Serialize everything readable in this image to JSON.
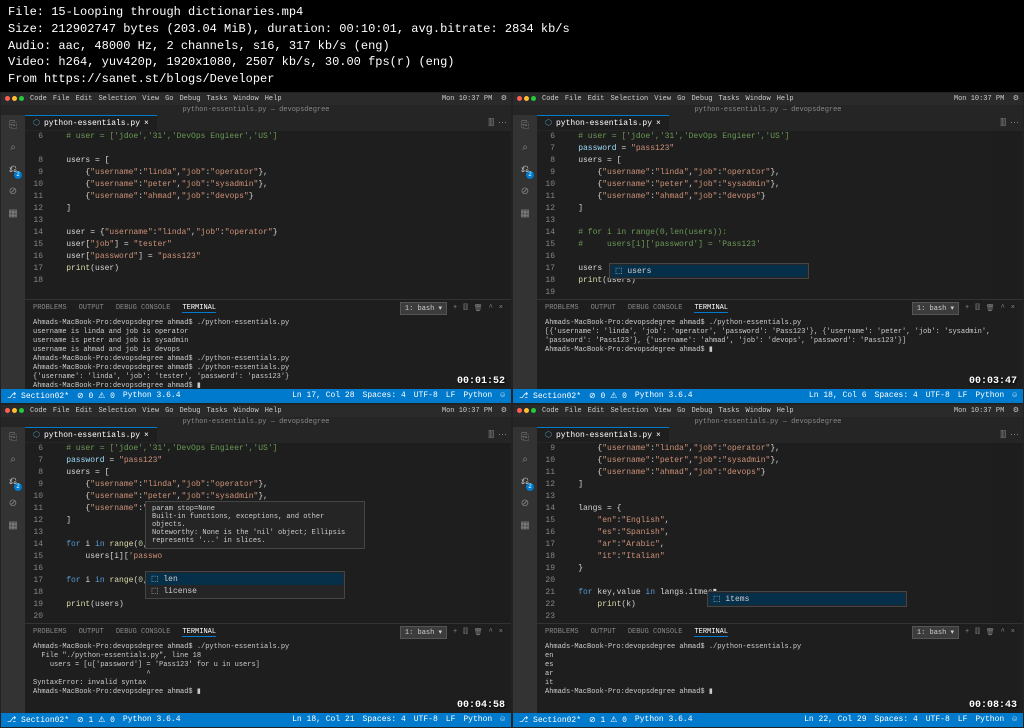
{
  "header": {
    "file_label": "File:",
    "file_value": "15-Looping through dictionaries.mp4",
    "size_label": "Size:",
    "size_value": "212902747 bytes (203.04 MiB), duration: 00:10:01, avg.bitrate: 2834 kb/s",
    "audio_label": "Audio:",
    "audio_value": "aac, 48000 Hz, 2 channels, s16, 317 kb/s (eng)",
    "video_label": "Video:",
    "video_value": "h264, yuv420p, 1920x1080, 2507 kb/s, 30.00 fps(r) (eng)",
    "from_label": "From",
    "from_value": "https://sanet.st/blogs/Developer"
  },
  "mac_menu": [
    "Code",
    "File",
    "Edit",
    "Selection",
    "View",
    "Go",
    "Debug",
    "Tasks",
    "Window",
    "Help"
  ],
  "titlebar": "python-essentials.py — devopsdegree",
  "tab_name": "python-essentials.py",
  "panel_tabs": [
    "PROBLEMS",
    "OUTPUT",
    "DEBUG CONSOLE",
    "TERMINAL"
  ],
  "term_shell": "1: bash",
  "panes": {
    "a": {
      "lines": [
        "6",
        "",
        "8",
        "9",
        "10",
        "11",
        "12",
        "13",
        "14",
        "15",
        "16",
        "17",
        "18"
      ],
      "code": "    <span class='c-c'># user = ['jdoe','31','DevOps Engieer','US']</span>\n\n    users = [\n        {<span class='c-s'>\"username\"</span>:<span class='c-s'>\"linda\"</span>,<span class='c-s'>\"job\"</span>:<span class='c-s'>\"operator\"</span>},\n        {<span class='c-s'>\"username\"</span>:<span class='c-s'>\"peter\"</span>,<span class='c-s'>\"job\"</span>:<span class='c-s'>\"sysadmin\"</span>},\n        {<span class='c-s'>\"username\"</span>:<span class='c-s'>\"ahmad\"</span>,<span class='c-s'>\"job\"</span>:<span class='c-s'>\"devops\"</span>}\n    ]\n\n    user = {<span class='c-s'>\"username\"</span>:<span class='c-s'>\"linda\"</span>,<span class='c-s'>\"job\"</span>:<span class='c-s'>\"operator\"</span>}\n    user[<span class='c-s'>\"job\"</span>] = <span class='c-s'>\"tester\"</span>\n    user[<span class='c-s'>\"password\"</span>] = <span class='c-s'>\"pass123\"</span>\n    <span class='c-f'>print</span>(user)",
      "terminal": "Ahmads-MacBook-Pro:devopsdegree ahmad$ ./python-essentials.py\nusername is linda and job is operator\nusername is peter and job is sysadmin\nusername is ahmad and job is devops\nAhmads-MacBook-Pro:devopsdegree ahmad$ ./python-essentials.py\nAhmads-MacBook-Pro:devopsdegree ahmad$ ./python-essentials.py\n{'username': 'linda', 'job': 'tester', 'password': 'pass123'}\nAhmads-MacBook-Pro:devopsdegree ahmad$ ▮",
      "status_left": [
        "⎇ Section02*",
        "⊘ 0 ⚠ 0",
        "Python 3.6.4"
      ],
      "status_right": [
        "Ln 17, Col 28",
        "Spaces: 4",
        "UTF-8",
        "LF",
        "Python"
      ],
      "timestamp": "00:01:52"
    },
    "b": {
      "lines": [
        "6",
        "7",
        "8",
        "9",
        "10",
        "11",
        "12",
        "13",
        "14",
        "15",
        "16",
        "17",
        "18",
        "19"
      ],
      "code": "    <span class='c-c'># user = ['jdoe','31','DevOps Engieer','US']</span>\n    <span class='c-v'>password</span> = <span class='c-s'>\"pass123\"</span>\n    users = [\n        {<span class='c-s'>\"username\"</span>:<span class='c-s'>\"linda\"</span>,<span class='c-s'>\"job\"</span>:<span class='c-s'>\"operator\"</span>},\n        {<span class='c-s'>\"username\"</span>:<span class='c-s'>\"peter\"</span>,<span class='c-s'>\"job\"</span>:<span class='c-s'>\"sysadmin\"</span>},\n        {<span class='c-s'>\"username\"</span>:<span class='c-s'>\"ahmad\"</span>,<span class='c-s'>\"job\"</span>:<span class='c-s'>\"devops\"</span>}\n    ]\n\n    <span class='c-c'># for i in range(0,len(users)):</span>\n    <span class='c-c'>#     users[i]['password'] = 'Pass123'</span>\n\n    users\n    <span class='c-f'>print</span>(users)",
      "suggest": "users",
      "terminal": "Ahmads-MacBook-Pro:devopsdegree ahmad$ ./python-essentials.py\n[{'username': 'linda', 'job': 'operator', 'password': 'Pass123'}, {'username': 'peter', 'job': 'sysadmin', 'password': 'Pass123'}, {'username': 'ahmad', 'job': 'devops', 'password': 'Pass123'}]\nAhmads-MacBook-Pro:devopsdegree ahmad$ ▮",
      "status_left": [
        "⎇ Section02*",
        "⊘ 0 ⚠ 0",
        "Python 3.6.4"
      ],
      "status_right": [
        "Ln 18, Col 6",
        "Spaces: 4",
        "UTF-8",
        "LF",
        "Python"
      ],
      "timestamp": "00:03:47"
    },
    "c": {
      "lines": [
        "6",
        "7",
        "8",
        "9",
        "10",
        "11",
        "12",
        "13",
        "14",
        "15",
        "16",
        "17",
        "18",
        "19",
        "20"
      ],
      "code": "    <span class='c-c'># user = ['jdoe','31','DevOps Engieer','US']</span>\n    <span class='c-v'>password</span> = <span class='c-s'>\"pass123\"</span>\n    users = [\n        {<span class='c-s'>\"username\"</span>:<span class='c-s'>\"linda\"</span>,<span class='c-s'>\"job\"</span>:<span class='c-s'>\"operator\"</span>},\n        {<span class='c-s'>\"username\"</span>:<span class='c-s'>\"peter\"</span>,<span class='c-s'>\"job\"</span>:<span class='c-s'>\"sysadmin\"</span>},\n        {<span class='c-s'>\"username\"</span>:<span class='c-s'>\"aha</span> <span class='c-f'>range</span>(start, <span class='c-v'>stop</span>=None, step=1)\n    ]\n\n    <span class='c-k'>for</span> i <span class='c-k'>in</span> <span class='c-f'>range</span>(<span class='c-n'>0</span>,len\n        users[i][<span class='c-s'>'passwo</span>\n\n    <span class='c-k'>for</span> i <span class='c-k'>in</span> <span class='c-f'>range</span>(<span class='c-n'>0</span>,len▮\n\n    <span class='c-f'>print</span>(users)",
      "tooltip": "param stop=None\nBuilt-in functions, exceptions, and other objects.\nNoteworthy: None is the 'nil' object; Ellipsis represents '...' in slices.",
      "suggest_items": [
        "len",
        "license"
      ],
      "terminal": "Ahmads-MacBook-Pro:devopsdegree ahmad$ ./python-essentials.py\n  File \"./python-essentials.py\", line 18\n    users = [u['password'] = 'Pass123' for u in users]\n                           ^\nSyntaxError: invalid syntax\nAhmads-MacBook-Pro:devopsdegree ahmad$ ▮",
      "status_left": [
        "⎇ Section02*",
        "⊘ 1 ⚠ 0",
        "Python 3.6.4"
      ],
      "status_right": [
        "Ln 18, Col 21",
        "Spaces: 4",
        "UTF-8",
        "LF",
        "Python"
      ],
      "timestamp": "00:04:58"
    },
    "d": {
      "lines": [
        "9",
        "10",
        "11",
        "12",
        "13",
        "14",
        "15",
        "16",
        "17",
        "18",
        "19",
        "20",
        "21",
        "22",
        "23"
      ],
      "code": "        {<span class='c-s'>\"username\"</span>:<span class='c-s'>\"linda\"</span>,<span class='c-s'>\"job\"</span>:<span class='c-s'>\"operator\"</span>},\n        {<span class='c-s'>\"username\"</span>:<span class='c-s'>\"peter\"</span>,<span class='c-s'>\"job\"</span>:<span class='c-s'>\"sysadmin\"</span>},\n        {<span class='c-s'>\"username\"</span>:<span class='c-s'>\"ahmad\"</span>,<span class='c-s'>\"job\"</span>:<span class='c-s'>\"devops\"</span>}\n    ]\n\n    langs = {\n        <span class='c-s'>\"en\"</span>:<span class='c-s'>\"English\"</span>,\n        <span class='c-s'>\"es\"</span>:<span class='c-s'>\"Spanish\"</span>,\n        <span class='c-s'>\"ar\"</span>:<span class='c-s'>\"Arabic\"</span>,\n        <span class='c-s'>\"it\"</span>:<span class='c-s'>\"Italian\"</span>\n    }\n\n    <span class='c-k'>for</span> key,value <span class='c-k'>in</span> langs.itmes▮\n        <span class='c-f'>print</span>(k)",
      "suggest": "items",
      "terminal": "Ahmads-MacBook-Pro:devopsdegree ahmad$ ./python-essentials.py\nen\nes\nar\nit\nAhmads-MacBook-Pro:devopsdegree ahmad$ ▮",
      "status_left": [
        "⎇ Section02*",
        "⊘ 1 ⚠ 0",
        "Python 3.6.4"
      ],
      "status_right": [
        "Ln 22, Col 29",
        "Spaces: 4",
        "UTF-8",
        "LF",
        "Python"
      ],
      "timestamp": "00:08:43"
    }
  }
}
